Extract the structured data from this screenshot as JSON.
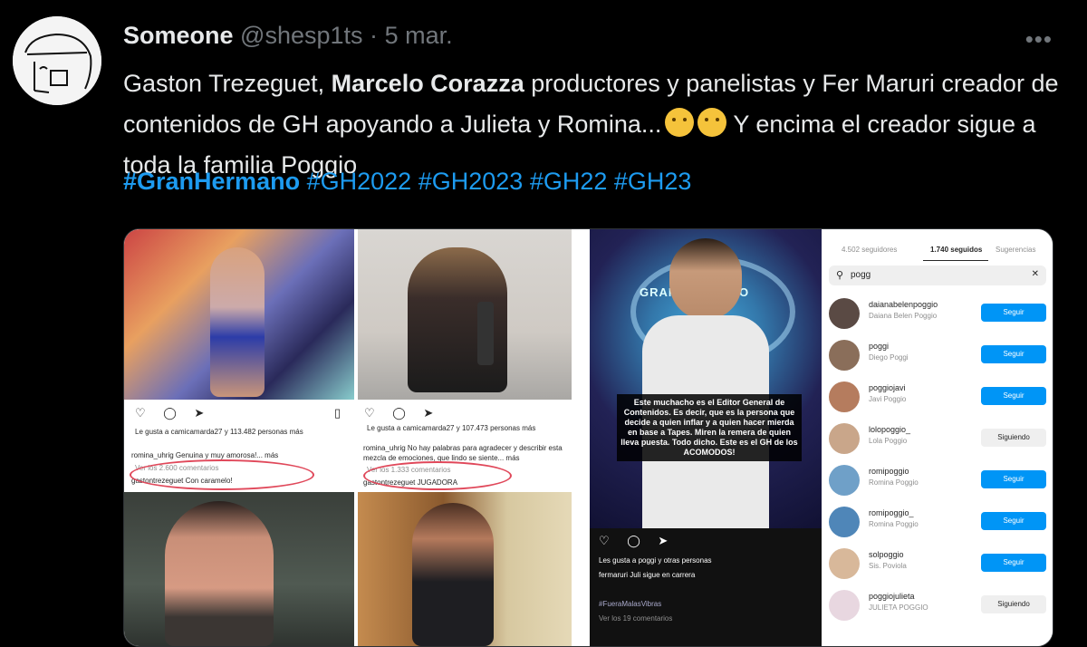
{
  "tweet": {
    "author_name": "Someone",
    "handle": "@shesp1ts",
    "separator": "·",
    "date": "5 mar.",
    "more": "•••",
    "text": {
      "part1": "Gaston Trezeguet, ",
      "bold1": "Marcelo Corazza",
      "part2": " productores y panelistas y Fer Maruri creador de contenidos de GH apoyando a Julieta y Romina...",
      "part3": " Y encima el creador sigue a toda la familia Poggio"
    },
    "hashtags": [
      "#GranHermano",
      "#GH2022",
      "#GH2023",
      "#GH22",
      "#GH23"
    ],
    "emojis": [
      "face-with-raised-eyebrow-icon",
      "thinking-face-icon"
    ]
  },
  "media": {
    "ig_post1": {
      "likes": "Le gusta a camicamarda27 y 113.482 personas más",
      "caption": "romina_uhrig Genuina y muy amorosa!... más",
      "view_comments": "Ver los 2.600 comentarios",
      "comment": "gastontrezeguet Con caramelo!"
    },
    "ig_post2": {
      "likes": "Le gusta a camicamarda27 y 107.473 personas más",
      "caption": "romina_uhrig No hay palabras para agradecer y describir esta mezcla de emociones, que lindo se siente... más",
      "view_comments": "Ver los 1.333 comentarios",
      "comment": "gastontrezeguet JUGADORA"
    },
    "ig_post3": {
      "overlay_text": "Este muchacho es el Editor General de Contenidos. Es decir, que es la persona que decide a quien inflar y a quien hacer mierda en base a Tapes. Miren la remera de quien lleva puesta. Todo dicho. Este es el GH de los ACOMODOS!",
      "logo_text": "GRAN HERMANO",
      "likes": "Les gusta a poggi y otras personas",
      "comment": "fermaruri Juli sigue en carrera",
      "hashtag": "#FueraMalasVibras",
      "view_comments": "Ver los 19 comentarios"
    },
    "following": {
      "tabs": [
        "4.502 seguidores",
        "1.740 seguidos",
        "Sugerencias"
      ],
      "search_value": "pogg",
      "users": [
        {
          "username": "daianabelenpoggio",
          "fullname": "Daiana Belen Poggio",
          "button": "Seguir"
        },
        {
          "username": "poggi",
          "fullname": "Diego Poggi",
          "button": "Seguir"
        },
        {
          "username": "poggiojavi",
          "fullname": "Javi Poggio",
          "button": "Seguir"
        },
        {
          "username": "lolopoggio_",
          "fullname": "Lola Poggio",
          "button": "Siguiendo"
        },
        {
          "username": "romipoggio",
          "fullname": "Romina Poggio",
          "button": "Seguir"
        },
        {
          "username": "romipoggio_",
          "fullname": "Romina Poggio",
          "button": "Seguir"
        },
        {
          "username": "solpoggio",
          "fullname": "Sis. Poviola",
          "button": "Seguir"
        },
        {
          "username": "poggiojulieta",
          "fullname": "JULIETA POGGIO",
          "button": "Siguiendo"
        }
      ]
    }
  },
  "colors": {
    "background": "#000000",
    "link": "#1d9bf0",
    "muted": "#71767b",
    "ig_blue": "#0095f6"
  }
}
